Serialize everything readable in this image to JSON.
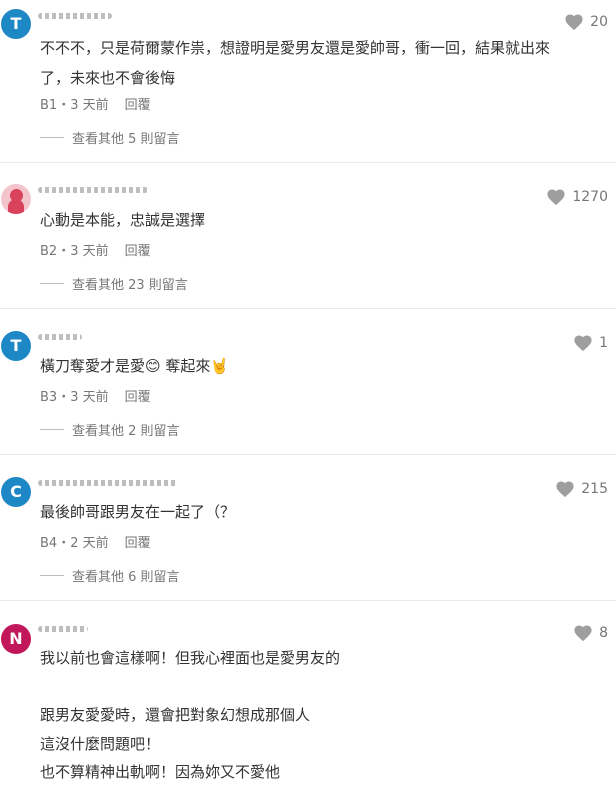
{
  "comments": [
    {
      "avatar_letter": "T",
      "avatar_color": "#1E88C7",
      "likes": "20",
      "lines": [
        "不不不，只是荷爾蒙作祟，想證明是愛男友還是愛帥哥，衝一回，結果就出來",
        "了，未來也不會後悔"
      ],
      "floor_time": "B1・3 天前",
      "reply_label": "回覆",
      "more_label": "查看其他 5 則留言"
    },
    {
      "avatar_color": "#D9425B",
      "likes": "1270",
      "lines": [
        "心動是本能，忠誠是選擇"
      ],
      "floor_time": "B2・3 天前",
      "reply_label": "回覆",
      "more_label": "查看其他 23 則留言"
    },
    {
      "avatar_letter": "T",
      "avatar_color": "#1E88C7",
      "likes": "1",
      "lines": [
        "橫刀奪愛才是愛😊 奪起來🤘"
      ],
      "floor_time": "B3・3 天前",
      "reply_label": "回覆",
      "more_label": "查看其他 2 則留言"
    },
    {
      "avatar_letter": "C",
      "avatar_color": "#1E88C7",
      "likes": "215",
      "lines": [
        "最後帥哥跟男友在一起了（？"
      ],
      "floor_time": "B4・2 天前",
      "reply_label": "回覆",
      "more_label": "查看其他 6 則留言"
    },
    {
      "avatar_letter": "N",
      "avatar_color": "#C2185B",
      "likes": "8",
      "lines": [
        "我以前也會這樣啊！但我心裡面也是愛男友的",
        "",
        "跟男友愛愛時，還會把對象幻想成那個人",
        "這沒什麼問題吧！",
        "也不算精神出軌啊！因為妳又不愛他"
      ]
    }
  ]
}
